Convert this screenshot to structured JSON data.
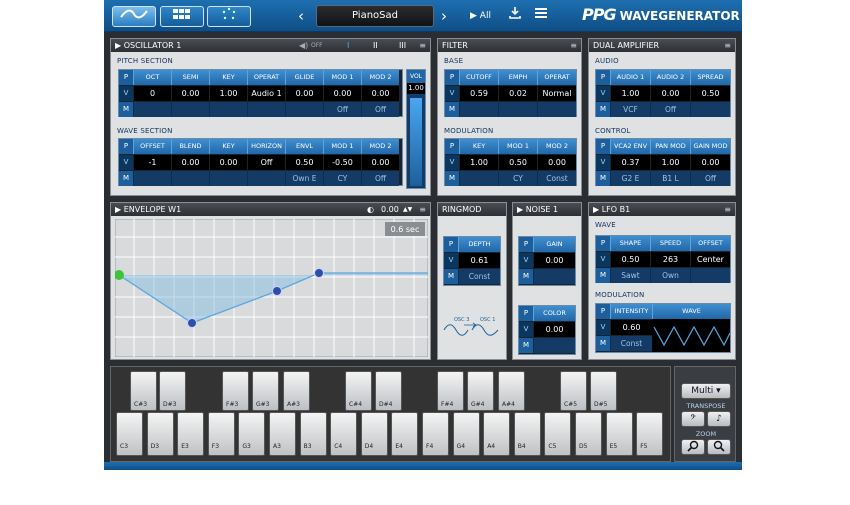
{
  "toolbar": {
    "tab1_icon": "wave-icon",
    "tab2_icon": "grid-icon",
    "tab3_icon": "circle-dots-icon",
    "prev": "‹",
    "next": "›",
    "preset": "PianoSad",
    "filter": "▶ All",
    "brand_ppg": "PPG",
    "brand_name": "WAVEGENERATOR"
  },
  "osc": {
    "title": "▶ OSCILLATOR 1",
    "off": "OFF",
    "b1": "I",
    "b2": "II",
    "b3": "III",
    "pitch_title": "PITCH SECTION",
    "pitch_headers": [
      "OCT",
      "SEMI",
      "KEY",
      "OPERAT",
      "GLIDE",
      "MOD 1",
      "MOD 2"
    ],
    "pitch_values": [
      "0",
      "0.00",
      "1.00",
      "Audio 1",
      "0.00",
      "0.00",
      "0.00"
    ],
    "pitch_mods": [
      "",
      "",
      "",
      "",
      "",
      "Off",
      "Off"
    ],
    "vol_label": "VOL",
    "vol_value": "1.00",
    "wave_title": "WAVE SECTION",
    "wave_headers": [
      "OFFSET",
      "BLEND",
      "KEY",
      "HORIZON",
      "ENVL",
      "MOD 1",
      "MOD 2"
    ],
    "wave_values": [
      "-1",
      "0.00",
      "0.00",
      "Off",
      "0.50",
      "-0.50",
      "0.00"
    ],
    "wave_mods": [
      "",
      "",
      "",
      "",
      "Own E",
      "CY",
      "Off"
    ]
  },
  "filter": {
    "title": "FILTER",
    "base_title": "BASE",
    "base_headers": [
      "CUTOFF",
      "EMPH",
      "OPERAT"
    ],
    "base_values": [
      "0.59",
      "0.02",
      "Normal"
    ],
    "base_mods": [
      "",
      "",
      ""
    ],
    "mod_title": "MODULATION",
    "mod_headers": [
      "KEY",
      "MOD 1",
      "MOD 2"
    ],
    "mod_values": [
      "1.00",
      "0.50",
      "0.00"
    ],
    "mod_mods": [
      "",
      "CY",
      "Const"
    ]
  },
  "amp": {
    "title": "DUAL AMPLIFIER",
    "audio_title": "AUDIO",
    "audio_headers": [
      "AUDIO 1",
      "AUDIO 2",
      "SPREAD"
    ],
    "audio_values": [
      "1.00",
      "0.00",
      "0.50"
    ],
    "audio_mods": [
      "VCF",
      "Off",
      ""
    ],
    "ctrl_title": "CONTROL",
    "ctrl_headers": [
      "VCA2 ENV",
      "PAN MOD",
      "GAIN MOD"
    ],
    "ctrl_values": [
      "0.37",
      "1.00",
      "0.00"
    ],
    "ctrl_mods": [
      "G2 E",
      "B1 L",
      "Off"
    ]
  },
  "env": {
    "title": "▶ ENVELOPE W1",
    "value": "0.00",
    "time": "0.6 sec"
  },
  "ring": {
    "title": "RINGMOD",
    "depth_label": "DEPTH",
    "depth_value": "0.61",
    "depth_mod": "Const",
    "osc3": "OSC 3",
    "osc1": "OSC 1"
  },
  "noise": {
    "title": "▶ NOISE 1",
    "gain_label": "GAIN",
    "gain_value": "0.00",
    "color_label": "COLOR",
    "color_value": "0.00"
  },
  "lfo": {
    "title": "▶ LFO B1",
    "wave_title": "WAVE",
    "wave_headers": [
      "SHAPE",
      "SPEED",
      "OFFSET"
    ],
    "wave_values": [
      "0.50",
      "263",
      "Center"
    ],
    "wave_mods": [
      "Sawt",
      "Own",
      ""
    ],
    "mod_title": "MODULATION",
    "intensity_label": "INTENSITY",
    "wave_label": "WAVE",
    "intensity_value": "0.60",
    "intensity_mod": "Const"
  },
  "rowlabels": {
    "p": "P",
    "v": "V",
    "m": "M"
  },
  "keyboard": {
    "black": [
      "C#3",
      "D#3",
      "F#3",
      "G#3",
      "A#3",
      "C#4",
      "D#4",
      "F#4",
      "G#4",
      "A#4",
      "C#5",
      "D#5"
    ],
    "white": [
      "C3",
      "D3",
      "E3",
      "F3",
      "G3",
      "A3",
      "B3",
      "C4",
      "D4",
      "E4",
      "F4",
      "G4",
      "A4",
      "B4",
      "C5",
      "D5",
      "E5",
      "F5"
    ]
  },
  "right": {
    "mode": "Multi ▾",
    "transpose": "TRANSPOSE",
    "zoom": "ZOOM",
    "t_down_icon": "bass-clef-icon",
    "t_up_icon": "note-icon",
    "z_out_icon": "zoom-out-icon",
    "z_in_icon": "zoom-in-icon"
  },
  "colors": {
    "accent": "#2167a8",
    "header": "#3f8fd0",
    "dark": "#2a2d31"
  }
}
